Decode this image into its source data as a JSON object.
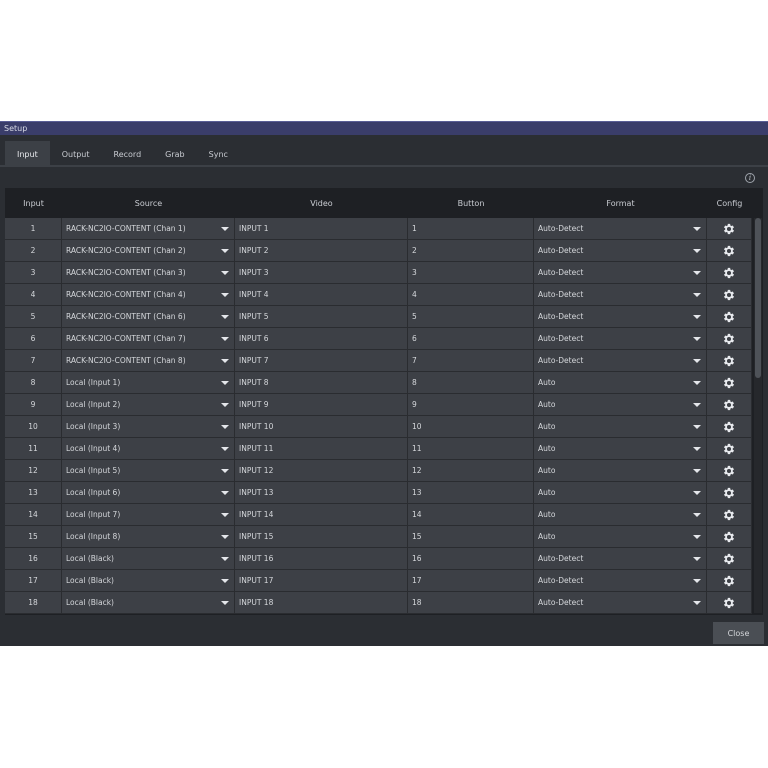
{
  "window": {
    "title": "Setup"
  },
  "tabs": [
    {
      "label": "Input",
      "active": true
    },
    {
      "label": "Output",
      "active": false
    },
    {
      "label": "Record",
      "active": false
    },
    {
      "label": "Grab",
      "active": false
    },
    {
      "label": "Sync",
      "active": false
    }
  ],
  "info_icon_glyph": "i",
  "table": {
    "headers": {
      "input": "Input",
      "source": "Source",
      "video": "Video",
      "button": "Button",
      "format": "Format",
      "config": "Config"
    },
    "rows": [
      {
        "input": "1",
        "source": "RACK-NC2IO-CONTENT (Chan 1)",
        "video": "INPUT 1",
        "button": "1",
        "format": "Auto-Detect"
      },
      {
        "input": "2",
        "source": "RACK-NC2IO-CONTENT (Chan 2)",
        "video": "INPUT 2",
        "button": "2",
        "format": "Auto-Detect"
      },
      {
        "input": "3",
        "source": "RACK-NC2IO-CONTENT (Chan 3)",
        "video": "INPUT 3",
        "button": "3",
        "format": "Auto-Detect"
      },
      {
        "input": "4",
        "source": "RACK-NC2IO-CONTENT (Chan 4)",
        "video": "INPUT 4",
        "button": "4",
        "format": "Auto-Detect"
      },
      {
        "input": "5",
        "source": "RACK-NC2IO-CONTENT (Chan 6)",
        "video": "INPUT 5",
        "button": "5",
        "format": "Auto-Detect"
      },
      {
        "input": "6",
        "source": "RACK-NC2IO-CONTENT (Chan 7)",
        "video": "INPUT 6",
        "button": "6",
        "format": "Auto-Detect"
      },
      {
        "input": "7",
        "source": "RACK-NC2IO-CONTENT (Chan 8)",
        "video": "INPUT 7",
        "button": "7",
        "format": "Auto-Detect"
      },
      {
        "input": "8",
        "source": "Local (Input 1)",
        "video": "INPUT 8",
        "button": "8",
        "format": "Auto"
      },
      {
        "input": "9",
        "source": "Local (Input 2)",
        "video": "INPUT 9",
        "button": "9",
        "format": "Auto"
      },
      {
        "input": "10",
        "source": "Local (Input 3)",
        "video": "INPUT 10",
        "button": "10",
        "format": "Auto"
      },
      {
        "input": "11",
        "source": "Local (Input 4)",
        "video": "INPUT 11",
        "button": "11",
        "format": "Auto"
      },
      {
        "input": "12",
        "source": "Local (Input 5)",
        "video": "INPUT 12",
        "button": "12",
        "format": "Auto"
      },
      {
        "input": "13",
        "source": "Local (Input 6)",
        "video": "INPUT 13",
        "button": "13",
        "format": "Auto"
      },
      {
        "input": "14",
        "source": "Local (Input 7)",
        "video": "INPUT 14",
        "button": "14",
        "format": "Auto"
      },
      {
        "input": "15",
        "source": "Local (Input 8)",
        "video": "INPUT 15",
        "button": "15",
        "format": "Auto"
      },
      {
        "input": "16",
        "source": "Local (Black)",
        "video": "INPUT 16",
        "button": "16",
        "format": "Auto-Detect"
      },
      {
        "input": "17",
        "source": "Local (Black)",
        "video": "INPUT 17",
        "button": "17",
        "format": "Auto-Detect"
      },
      {
        "input": "18",
        "source": "Local (Black)",
        "video": "INPUT 18",
        "button": "18",
        "format": "Auto-Detect"
      }
    ]
  },
  "footer": {
    "close_label": "Close"
  },
  "colors": {
    "titlebar": "#3a3d6a",
    "panel": "#2b2e33",
    "cell": "#3d4046",
    "table_bg": "#1e2024"
  }
}
